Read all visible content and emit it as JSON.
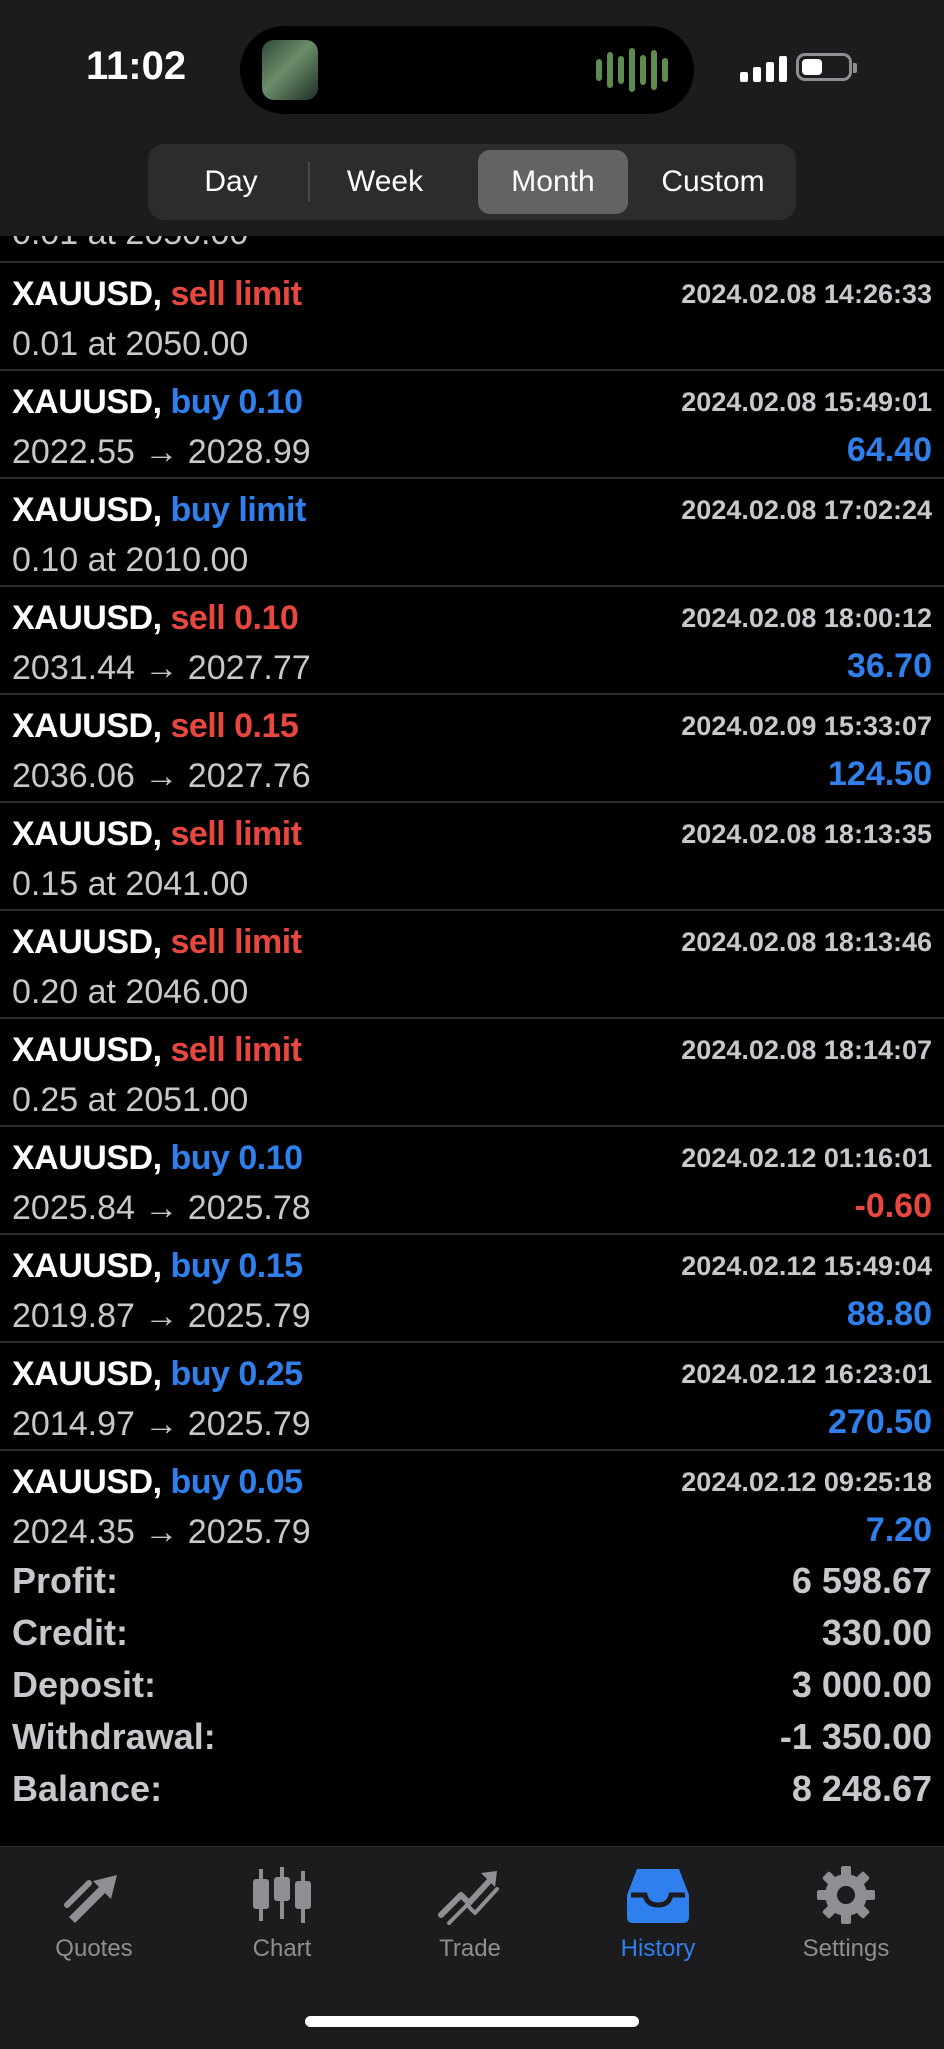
{
  "status": {
    "time": "11:02"
  },
  "periods": [
    "Day",
    "Week",
    "Month",
    "Custom"
  ],
  "active_period": "Month",
  "partial_row_text": "0.01 at 2050.00",
  "deals": [
    {
      "symbol": "XAUUSD,",
      "type": "sell limit",
      "side": "sell",
      "time": "2024.02.08 14:26:33",
      "detail": "0.01 at 2050.00",
      "profit": ""
    },
    {
      "symbol": "XAUUSD,",
      "type": "buy 0.10",
      "side": "buy",
      "time": "2024.02.08 15:49:01",
      "detail": "2022.55 → 2028.99",
      "profit": "64.40"
    },
    {
      "symbol": "XAUUSD,",
      "type": "buy limit",
      "side": "buy",
      "time": "2024.02.08 17:02:24",
      "detail": "0.10 at 2010.00",
      "profit": ""
    },
    {
      "symbol": "XAUUSD,",
      "type": "sell 0.10",
      "side": "sell",
      "time": "2024.02.08 18:00:12",
      "detail": "2031.44 → 2027.77",
      "profit": "36.70"
    },
    {
      "symbol": "XAUUSD,",
      "type": "sell 0.15",
      "side": "sell",
      "time": "2024.02.09 15:33:07",
      "detail": "2036.06 → 2027.76",
      "profit": "124.50"
    },
    {
      "symbol": "XAUUSD,",
      "type": "sell limit",
      "side": "sell",
      "time": "2024.02.08 18:13:35",
      "detail": "0.15 at 2041.00",
      "profit": ""
    },
    {
      "symbol": "XAUUSD,",
      "type": "sell limit",
      "side": "sell",
      "time": "2024.02.08 18:13:46",
      "detail": "0.20 at 2046.00",
      "profit": ""
    },
    {
      "symbol": "XAUUSD,",
      "type": "sell limit",
      "side": "sell",
      "time": "2024.02.08 18:14:07",
      "detail": "0.25 at 2051.00",
      "profit": ""
    },
    {
      "symbol": "XAUUSD,",
      "type": "buy 0.10",
      "side": "buy",
      "time": "2024.02.12 01:16:01",
      "detail": "2025.84 → 2025.78",
      "profit": "-0.60"
    },
    {
      "symbol": "XAUUSD,",
      "type": "buy 0.15",
      "side": "buy",
      "time": "2024.02.12 15:49:04",
      "detail": "2019.87 → 2025.79",
      "profit": "88.80"
    },
    {
      "symbol": "XAUUSD,",
      "type": "buy 0.25",
      "side": "buy",
      "time": "2024.02.12 16:23:01",
      "detail": "2014.97 → 2025.79",
      "profit": "270.50"
    },
    {
      "symbol": "XAUUSD,",
      "type": "buy 0.05",
      "side": "buy",
      "time": "2024.02.12 09:25:18",
      "detail": "2024.35 → 2025.79",
      "profit": "7.20"
    }
  ],
  "summary": [
    {
      "label": "Profit:",
      "value": "6 598.67"
    },
    {
      "label": "Credit:",
      "value": "330.00"
    },
    {
      "label": "Deposit:",
      "value": "3 000.00"
    },
    {
      "label": "Withdrawal:",
      "value": "-1 350.00"
    },
    {
      "label": "Balance:",
      "value": "8 248.67"
    }
  ],
  "tabs": [
    {
      "label": "Quotes",
      "icon": "quotes-icon"
    },
    {
      "label": "Chart",
      "icon": "chart-icon"
    },
    {
      "label": "Trade",
      "icon": "trade-icon"
    },
    {
      "label": "History",
      "icon": "history-icon"
    },
    {
      "label": "Settings",
      "icon": "settings-icon"
    }
  ],
  "active_tab": "History",
  "colors": {
    "sell": "#e8473f",
    "buy": "#2f80ed",
    "active_tab": "#2f80ed",
    "inactive_tab": "#8e8e93"
  }
}
